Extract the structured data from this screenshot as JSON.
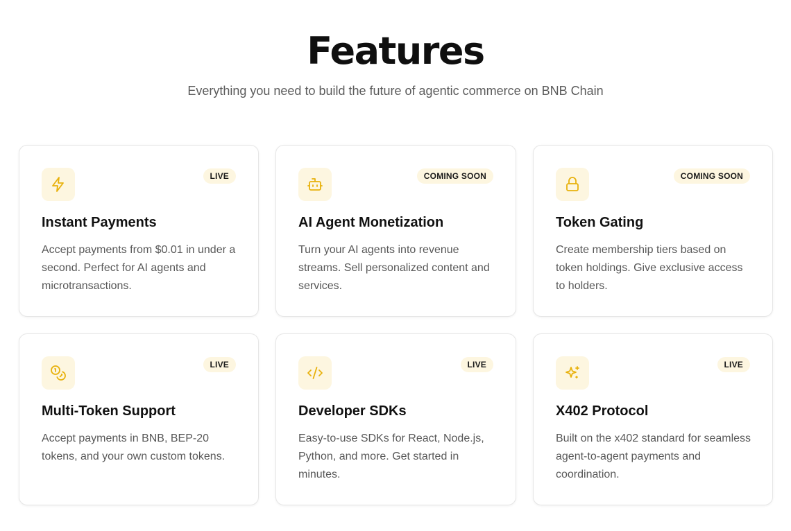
{
  "header": {
    "title": "Features",
    "subtitle": "Everything you need to build the future of agentic commerce on BNB Chain"
  },
  "colors": {
    "accent": "#e8b10c",
    "icon_bg": "#fdf6e0",
    "badge_bg": "#fdf6e0",
    "card_border": "#e6e6e6"
  },
  "features": [
    {
      "icon": "lightning-icon",
      "badge": "LIVE",
      "title": "Instant Payments",
      "description": "Accept payments from $0.01 in under a second. Perfect for AI agents and microtransactions."
    },
    {
      "icon": "robot-icon",
      "badge": "COMING SOON",
      "title": "AI Agent Monetization",
      "description": "Turn your AI agents into revenue streams. Sell personalized content and services."
    },
    {
      "icon": "lock-icon",
      "badge": "COMING SOON",
      "title": "Token Gating",
      "description": "Create membership tiers based on token holdings. Give exclusive access to holders."
    },
    {
      "icon": "coins-icon",
      "badge": "LIVE",
      "title": "Multi-Token Support",
      "description": "Accept payments in BNB, BEP-20 tokens, and your own custom tokens."
    },
    {
      "icon": "code-icon",
      "badge": "LIVE",
      "title": "Developer SDKs",
      "description": "Easy-to-use SDKs for React, Node.js, Python, and more. Get started in minutes."
    },
    {
      "icon": "sparkles-icon",
      "badge": "LIVE",
      "title": "X402 Protocol",
      "description": "Built on the x402 standard for seamless agent-to-agent payments and coordination."
    }
  ]
}
